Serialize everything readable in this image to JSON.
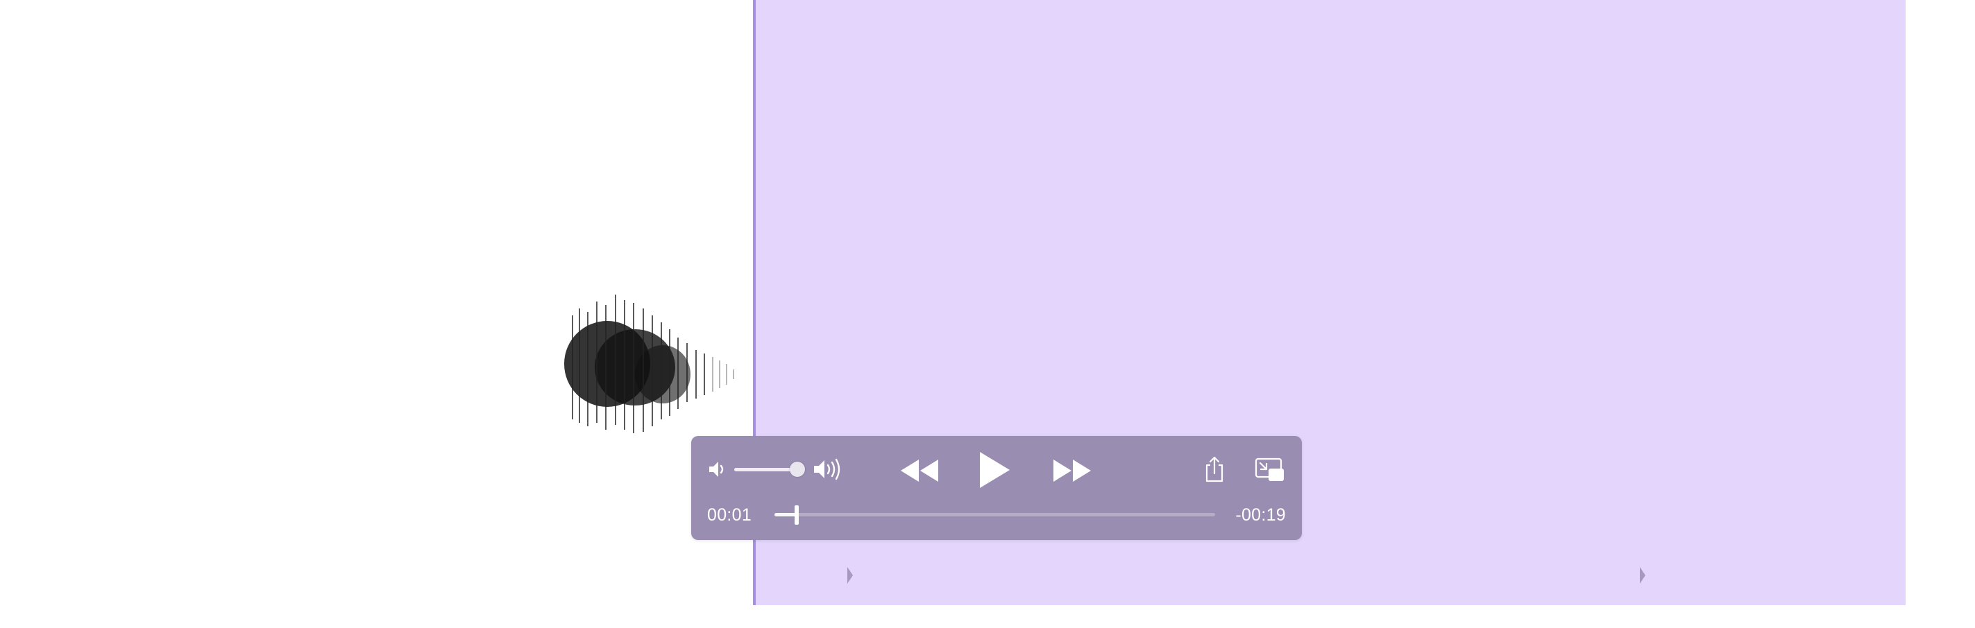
{
  "player": {
    "elapsed": "00:01",
    "remaining": "-00:19",
    "progress_fraction": 0.05,
    "volume_fraction": 0.85
  },
  "icons": {
    "volume_low": "speaker-low-icon",
    "volume_high": "speaker-high-icon",
    "rewind": "rewind-icon",
    "play": "play-icon",
    "fast_forward": "fast-forward-icon",
    "share": "share-icon",
    "picture_in_picture": "picture-in-picture-icon"
  },
  "colors": {
    "selection": "#e3d5fc",
    "playhead": "#a68fe0",
    "controls_bg": "#9a8db2"
  }
}
